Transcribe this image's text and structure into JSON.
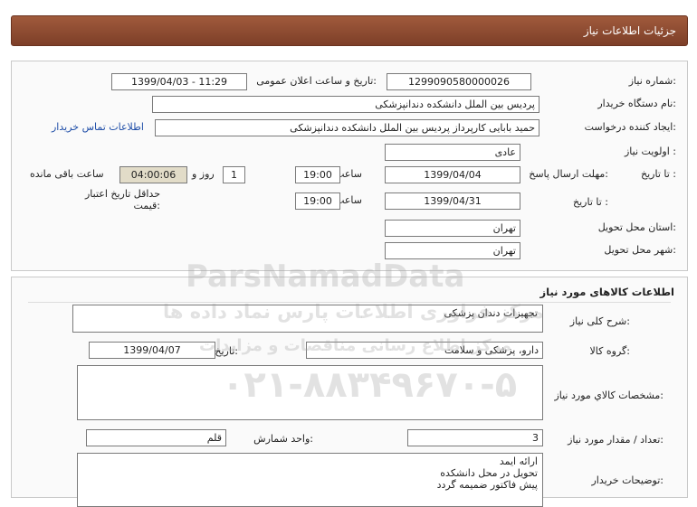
{
  "header": {
    "title": "جزئیات اطلاعات نیاز"
  },
  "need": {
    "number_label": "شماره نیاز:",
    "number": "1299090580000026",
    "announce_label": "تاریخ و ساعت اعلان عمومی:",
    "announce_value": "1399/04/03 - 11:29",
    "buyer_label": "نام دستگاه خریدار:",
    "buyer_value": "پردیس بین الملل دانشکده دندانپزشکی",
    "creator_label": "ایجاد کننده درخواست:",
    "creator_value": "حمید بابایی کارپرداز پردیس بین الملل دانشکده دندانپزشکی",
    "contact_link": "اطلاعات تماس خریدار",
    "priority_label": "اولویت نیاز :",
    "priority_value": "عادی",
    "deadline_label": "مهلت ارسال پاسخ:",
    "until_date_label": "تا تاریخ :",
    "deadline_date": "1399/04/04",
    "time_label": "ساعت",
    "deadline_time": "19:00",
    "days_value": "1",
    "days_label": "روز و",
    "remaining_value": "04:00:06",
    "remaining_label": "ساعت باقی مانده",
    "validity_label_1": "حداقل تاریخ اعتبار",
    "validity_label_2": "قیمت:",
    "validity_date": "1399/04/31",
    "validity_time": "19:00",
    "province_label": "استان محل تحویل:",
    "province_value": "تهران",
    "city_label": "شهر محل تحویل:",
    "city_value": "تهران"
  },
  "goods": {
    "section_title": "اطلاعات کالاهای مورد نیاز",
    "desc_label": "شرح کلی نیاز:",
    "desc_value": "تجهیزات دندان پزشکی",
    "group_label": "گروه کالا:",
    "group_value": "دارو، پزشکی و سلامت",
    "need_date_label": "تاریخ نیاز به کالا:",
    "need_date_value": "1399/04/07",
    "specs_label": "مشخصات کالاي مورد نیاز:",
    "specs_value": "",
    "qty_label": "تعداد / مقدار مورد نیاز:",
    "qty_value": "3",
    "unit_label": "واحد شمارش:",
    "unit_value": "قلم",
    "buyer_notes_label": "توضیحات خریدار:",
    "buyer_notes_line1": "ارائه ایمد",
    "buyer_notes_line2": "تحویل در محل دانشکده",
    "buyer_notes_line3": "پیش فاکتور ضمیمه گردد"
  },
  "watermark": {
    "brand": "ParsNamadData",
    "tagline": "مرکز فراوری اطلاعات پارس نماد داده ها",
    "subline": "مرکز اطلاع رسانی مناقصات و مزایدات",
    "phone": "۰۲۱-۸۸۳۴۹۶۷۰-۵"
  },
  "colors": {
    "header_bg": "#8b4a31",
    "link": "#1f4ea8",
    "countdown_bg": "#e2dcc8"
  }
}
